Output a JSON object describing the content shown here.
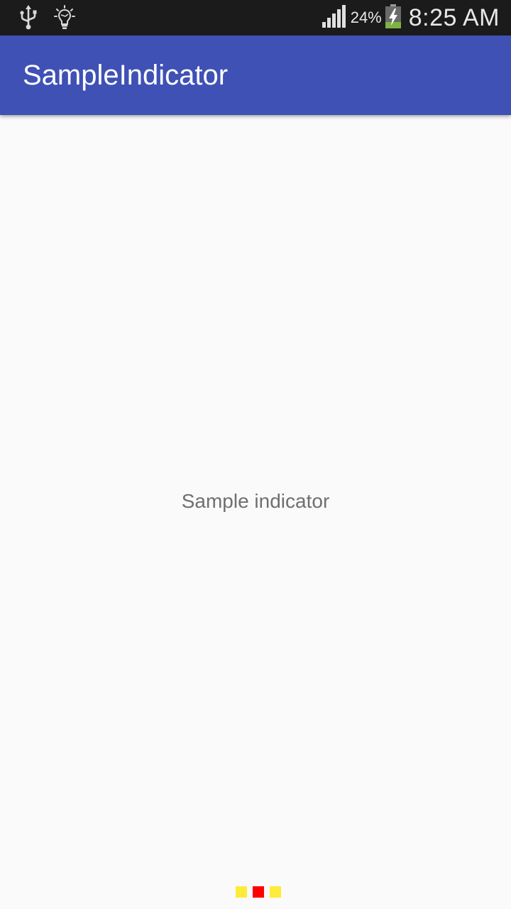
{
  "status_bar": {
    "left_icons": [
      "usb-icon",
      "lightbulb-icon"
    ],
    "signal_icon": "signal-icon",
    "battery_percent": "24%",
    "battery_icon": "battery-charging-icon",
    "time": "8:25 AM"
  },
  "app_bar": {
    "title": "SampleIndicator",
    "color": "#3f51b5"
  },
  "content": {
    "label": "Sample indicator"
  },
  "indicator": {
    "active_color": "#ff0000",
    "inactive_color": "#ffeb3b",
    "count": 3,
    "active_index": 1
  }
}
